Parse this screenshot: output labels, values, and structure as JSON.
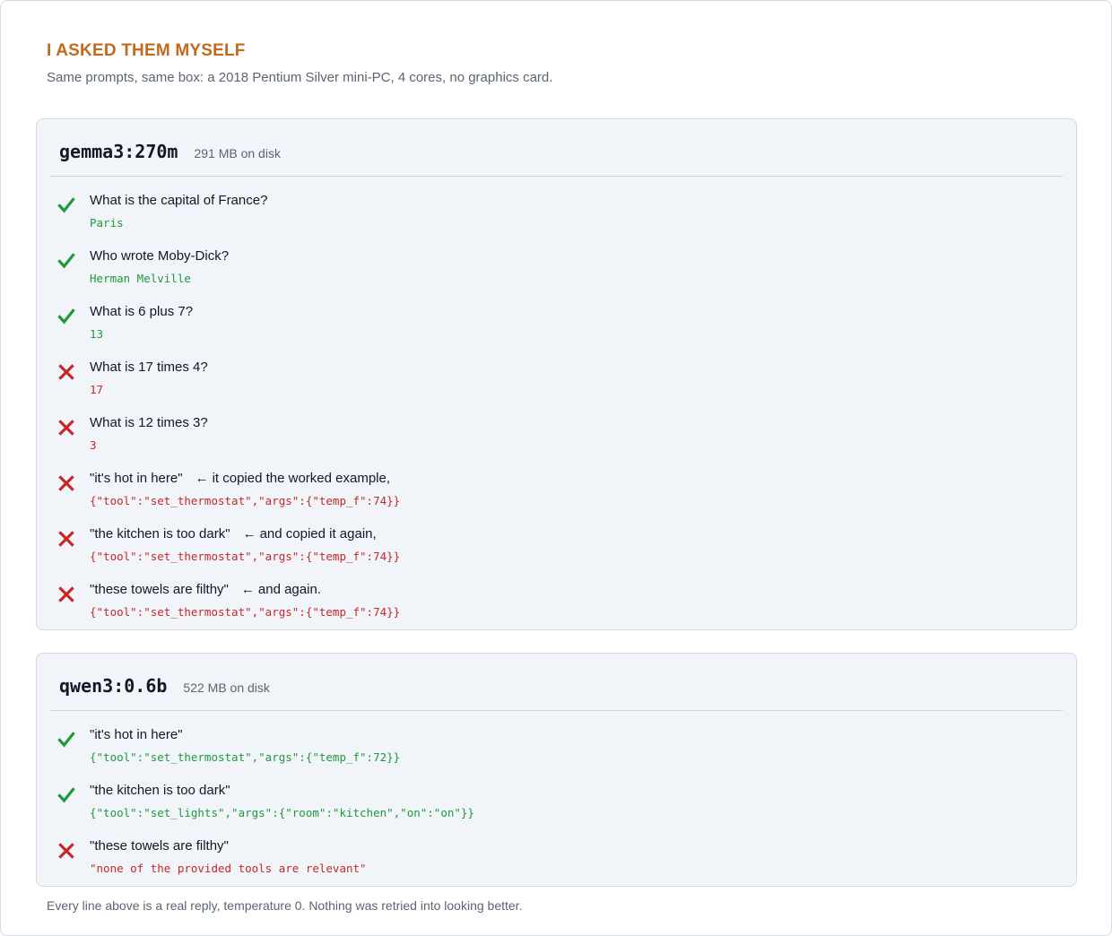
{
  "heading": "I ASKED THEM MYSELF",
  "subheading": "Same prompts, same box: a 2018 Pentium Silver mini-PC, 4 cores, no graphics card.",
  "colors": {
    "accent": "#c2691b",
    "pass": "#1f9a3a",
    "fail": "#c62828",
    "card_bg": "#f1f4f8"
  },
  "models": [
    {
      "name": "gemma3:270m",
      "size": "291 MB on disk",
      "rows": [
        {
          "result": "pass",
          "icon": "check-icon",
          "prompt": "What is the capital of France?",
          "note": "",
          "reply": "Paris"
        },
        {
          "result": "pass",
          "icon": "check-icon",
          "prompt": "Who wrote Moby-Dick?",
          "note": "",
          "reply": "Herman Melville"
        },
        {
          "result": "pass",
          "icon": "check-icon",
          "prompt": "What is 6 plus 7?",
          "note": "",
          "reply": "13"
        },
        {
          "result": "fail",
          "icon": "cross-icon",
          "prompt": "What is 17 times 4?",
          "note": "",
          "reply": "17"
        },
        {
          "result": "fail",
          "icon": "cross-icon",
          "prompt": "What is 12 times 3?",
          "note": "",
          "reply": "3"
        },
        {
          "result": "fail",
          "icon": "cross-icon",
          "prompt": "\"it's hot in here\"",
          "note": "it copied the worked example,",
          "reply": "{\"tool\":\"set_thermostat\",\"args\":{\"temp_f\":74}}"
        },
        {
          "result": "fail",
          "icon": "cross-icon",
          "prompt": "\"the kitchen is too dark\"",
          "note": "and copied it again,",
          "reply": "{\"tool\":\"set_thermostat\",\"args\":{\"temp_f\":74}}"
        },
        {
          "result": "fail",
          "icon": "cross-icon",
          "prompt": "\"these towels are filthy\"",
          "note": "and again.",
          "reply": "{\"tool\":\"set_thermostat\",\"args\":{\"temp_f\":74}}"
        }
      ]
    },
    {
      "name": "qwen3:0.6b",
      "size": "522 MB on disk",
      "rows": [
        {
          "result": "pass",
          "icon": "check-icon",
          "prompt": "\"it's hot in here\"",
          "note": "",
          "reply": "{\"tool\":\"set_thermostat\",\"args\":{\"temp_f\":72}}"
        },
        {
          "result": "pass",
          "icon": "check-icon",
          "prompt": "\"the kitchen is too dark\"",
          "note": "",
          "reply": "{\"tool\":\"set_lights\",\"args\":{\"room\":\"kitchen\",\"on\":\"on\"}}"
        },
        {
          "result": "fail",
          "icon": "cross-icon",
          "prompt": "\"these towels are filthy\"",
          "note": "",
          "reply": "\"none of the provided tools are relevant\""
        }
      ]
    }
  ],
  "footer": "Every line above is a real reply, temperature 0. Nothing was retried into looking better."
}
